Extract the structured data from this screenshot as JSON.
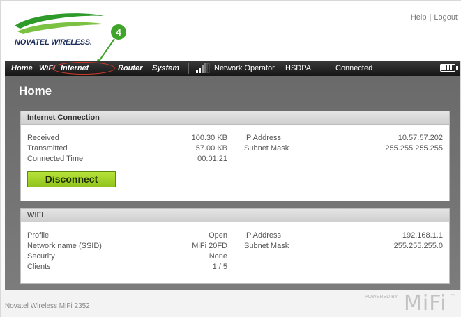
{
  "header": {
    "logo_text": "NOVATEL WIRELESS.",
    "links": {
      "help": "Help",
      "separator": "|",
      "logout": "Logout"
    },
    "callout_number": "4"
  },
  "nav": {
    "items": [
      "Home",
      "WiFi",
      "Internet",
      "Router",
      "System"
    ],
    "active": "Internet",
    "network_operator": "Network Operator",
    "network_type": "HSDPA",
    "connection_status": "Connected"
  },
  "page": {
    "title": "Home"
  },
  "internet_connection": {
    "title": "Internet Connection",
    "received_label": "Received",
    "received_value": "100.30 KB",
    "transmitted_label": "Transmitted",
    "transmitted_value": "57.00 KB",
    "connected_time_label": "Connected Time",
    "connected_time_value": "00:01:21",
    "ip_label": "IP Address",
    "ip_value": "10.57.57.202",
    "subnet_label": "Subnet Mask",
    "subnet_value": "255.255.255.255",
    "disconnect_label": "Disconnect"
  },
  "wifi": {
    "title": "WIFI",
    "profile_label": "Profile",
    "profile_value": "Open",
    "ssid_label": "Network name (SSID)",
    "ssid_value": "MiFi 20FD",
    "security_label": "Security",
    "security_value": "None",
    "clients_label": "Clients",
    "clients_value": "1 / 5",
    "ip_label": "IP Address",
    "ip_value": "192.168.1.1",
    "subnet_label": "Subnet Mask",
    "subnet_value": "255.255.255.0"
  },
  "footer": {
    "device": "Novatel Wireless MiFi 2352",
    "powered_by": "POWERED BY",
    "brand": "MiFi",
    "trademark": "™"
  },
  "colors": {
    "accent_green": "#8fc31c",
    "nav_bg": "#1e1e1e",
    "highlight_red": "#d23a2a",
    "content_bg": "#707070"
  },
  "icons": {
    "signal": "signal-bars-icon",
    "battery": "battery-icon"
  }
}
